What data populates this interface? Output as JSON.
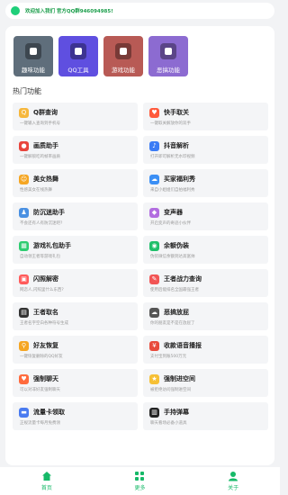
{
  "notice": {
    "text": "欢迎加入我们 官方QQ群946094985!"
  },
  "tiles": [
    {
      "label": "趣味功能",
      "color": "#5f6e7b"
    },
    {
      "label": "QQ工具",
      "color": "#5f4fe0"
    },
    {
      "label": "游戏功能",
      "color": "#b85a55"
    },
    {
      "label": "恶搞功能",
      "color": "#8c6bd1"
    }
  ],
  "section_title": "热门功能",
  "items": [
    {
      "name": "Q群查询",
      "desc": "一键输入查询到手机号",
      "icon_color": "#f6b73c",
      "icon": "Q"
    },
    {
      "name": "快手取关",
      "desc": "一键取关解放你的双手",
      "icon_color": "#ff5a3c",
      "icon": "♥"
    },
    {
      "name": "画质助手",
      "desc": "一键解锁吃鸡帧率画质",
      "icon_color": "#e8453c",
      "icon": "●"
    },
    {
      "name": "抖音解析",
      "desc": "打开即可解析无水印视频",
      "icon_color": "#3b7cf5",
      "icon": "♪"
    },
    {
      "name": "美女热舞",
      "desc": "性感美女在线热舞",
      "icon_color": "#f5a623",
      "icon": "☺"
    },
    {
      "name": "买家福利秀",
      "desc": "来自小姐姐们自拍福利秀",
      "icon_color": "#3b8ff5",
      "icon": "☁"
    },
    {
      "name": "防沉迷助手",
      "desc": "不会还有人有防沉迷吧?",
      "icon_color": "#4a90e2",
      "icon": "♟"
    },
    {
      "name": "变声器",
      "desc": "开启变声的奇迹小伙伴",
      "icon_color": "#b26de0",
      "icon": "◆"
    },
    {
      "name": "游戏礼包助手",
      "desc": "自动领王者等游戏礼包",
      "icon_color": "#2ecc71",
      "icon": "▦"
    },
    {
      "name": "余额伪装",
      "desc": "伪装微信余额到达高富帅",
      "icon_color": "#1fbf6a",
      "icon": "◉"
    },
    {
      "name": "闪照解密",
      "desc": "网恋人,闪照里什么东西?",
      "icon_color": "#ff5b5b",
      "icon": "▣"
    },
    {
      "name": "王者战力查询",
      "desc": "使用后能排名全国最强王者",
      "icon_color": "#f25555",
      "icon": "✎"
    },
    {
      "name": "王者取名",
      "desc": "王者名字空白各种符号生成",
      "icon_color": "#333333",
      "icon": "▤"
    },
    {
      "name": "恶搞放屁",
      "desc": "你的朋友是不是在放屁了",
      "icon_color": "#555555",
      "icon": "☁"
    },
    {
      "name": "好友恢复",
      "desc": "一键恢复删除的QQ好友",
      "icon_color": "#f5a623",
      "icon": "⚲"
    },
    {
      "name": "收款语音播报",
      "desc": "支付宝到账500万元",
      "icon_color": "#e84b3c",
      "icon": "¥"
    },
    {
      "name": "强制聊天",
      "desc": "可以对非好友强制聊天",
      "icon_color": "#ff6a3c",
      "icon": "♥"
    },
    {
      "name": "强制进空间",
      "desc": "被拒绝访问强制进空间",
      "icon_color": "#f6c035",
      "icon": "★"
    },
    {
      "name": "流量卡领取",
      "desc": "正规流量卡每月免费领",
      "icon_color": "#4a7bf0",
      "icon": "▬"
    },
    {
      "name": "手持弹幕",
      "desc": "聊天看场必备小道具",
      "icon_color": "#222222",
      "icon": "▥"
    }
  ],
  "tabs": [
    {
      "label": "首页",
      "icon": "home-icon"
    },
    {
      "label": "更多",
      "icon": "grid-icon"
    },
    {
      "label": "关于",
      "icon": "user-icon"
    }
  ],
  "accent_color": "#16b968"
}
